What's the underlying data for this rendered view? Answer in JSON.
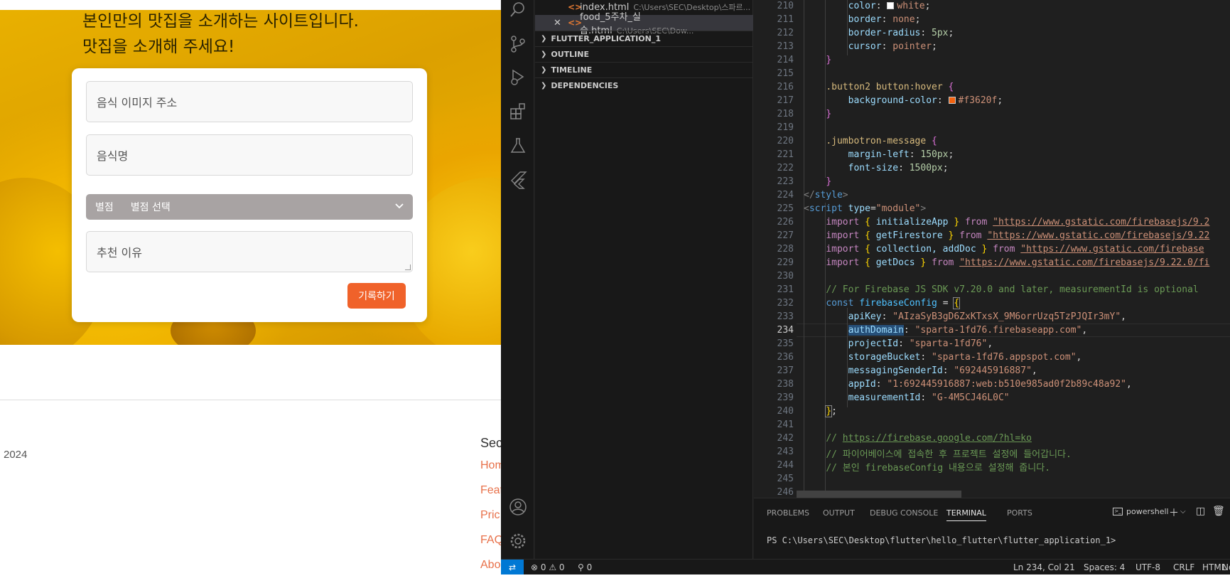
{
  "browser": {
    "hero_line1": "본인만의 맛집을 소개하는 사이트입니다.",
    "hero_line2": "맛집을 소개해 주세요!",
    "form": {
      "image_placeholder": "음식 이미지 주소",
      "name_placeholder": "음식명",
      "rating_label": "별점",
      "rating_value": "별점 선택",
      "reason_placeholder": "추천 이유",
      "submit_label": "기록하기"
    },
    "copyright": "2024",
    "footer": {
      "heading": "Sec",
      "links": [
        "Hom",
        "Feat",
        "Pric",
        "FAQ",
        "Abo"
      ]
    }
  },
  "vscode": {
    "open_editors": [
      {
        "name": "index.html",
        "path": "C:\\Users\\SEC\\Desktop\\스파르...",
        "active": false
      },
      {
        "name": "food_5주차_실습.html",
        "path": "C:\\Users\\SEC\\Dow...",
        "active": true
      }
    ],
    "sections": [
      "FLUTTER_APPLICATION_1",
      "OUTLINE",
      "TIMELINE",
      "DEPENDENCIES"
    ],
    "line_numbers": [
      "210",
      "211",
      "212",
      "213",
      "214",
      "215",
      "216",
      "217",
      "218",
      "219",
      "220",
      "221",
      "222",
      "223",
      "224",
      "225",
      "226",
      "227",
      "228",
      "229",
      "230",
      "231",
      "232",
      "233",
      "234",
      "235",
      "236",
      "237",
      "238",
      "239",
      "240",
      "241",
      "242",
      "243",
      "244",
      "245",
      "246"
    ],
    "active_line": "234",
    "code": {
      "l210_prop": "color",
      "l210_val": "white",
      "l211_prop": "border",
      "l211_val": "none",
      "l212_prop": "border-radius",
      "l212_val": "5px",
      "l213_prop": "cursor",
      "l213_val": "pointer",
      "l216_sel": ".button2 button:hover",
      "l217_prop": "background-color",
      "l217_val": "#f3620f",
      "l220_sel": ".jumbotron-message",
      "l221_prop": "margin-left",
      "l221_val": "150px",
      "l222_prop": "font-size",
      "l222_val": "1500px",
      "l224_tag": "style",
      "l225_tag": "script",
      "l225_attr": "type",
      "l225_val": "\"module\"",
      "l226_name": "initializeApp",
      "l226_url": "\"https://www.gstatic.com/firebasejs/9.2",
      "l227_name": "getFirestore",
      "l227_url": "\"https://www.gstatic.com/firebasejs/9.22",
      "l228_name": "collection, addDoc",
      "l228_url": "\"https://www.gstatic.com/firebase",
      "l229_name": "getDocs",
      "l229_url": "\"https://www.gstatic.com/firebasejs/9.22.0/fi",
      "l231_comment": "// For Firebase JS SDK v7.20.0 and later, measurementId is optional",
      "l232_var": "firebaseConfig",
      "l233_key": "apiKey",
      "l233_val": "\"AIzaSyB3gD6ZxKTxsX_9M6orrUzq5TzPJQIr3mY\"",
      "l234_key": "authDomain",
      "l234_val": "\"sparta-1fd76.firebaseapp.com\"",
      "l235_key": "projectId",
      "l235_val": "\"sparta-1fd76\"",
      "l236_key": "storageBucket",
      "l236_val": "\"sparta-1fd76.appspot.com\"",
      "l237_key": "messagingSenderId",
      "l237_val": "\"692445916887\"",
      "l238_key": "appId",
      "l238_val": "\"1:692445916887:web:b510e985ad0f2b89c48a92\"",
      "l239_key": "measurementId",
      "l239_val": "\"G-4M5CJ46L0C\"",
      "l242_comment_prefix": "// ",
      "l242_url": "https://firebase.google.com/?hl=ko",
      "l243_comment": "// 파이어베이스에 접속한 후 프로젝트 설정에 들어갑니다.",
      "l244_comment": "// 본인 firebaseConfig 내용으로 설정해 줍니다."
    },
    "panel_tabs": [
      "PROBLEMS",
      "OUTPUT",
      "DEBUG CONSOLE",
      "TERMINAL",
      "PORTS"
    ],
    "active_panel_tab": "TERMINAL",
    "terminal_shell": "powershell",
    "terminal_prompt": "PS C:\\Users\\SEC\\Desktop\\flutter\\hello_flutter\\flutter_application_1>",
    "status": {
      "errors": "0",
      "warnings": "0",
      "ports": "0",
      "cursor": "Ln 234, Col 21",
      "spaces": "Spaces: 4",
      "encoding": "UTF-8",
      "eol": "CRLF",
      "language": "HTML",
      "notifications": "No"
    },
    "colors": {
      "accent": "#0078d4",
      "button_orange": "#f0622a",
      "select_gray": "#a8a3a3"
    }
  }
}
